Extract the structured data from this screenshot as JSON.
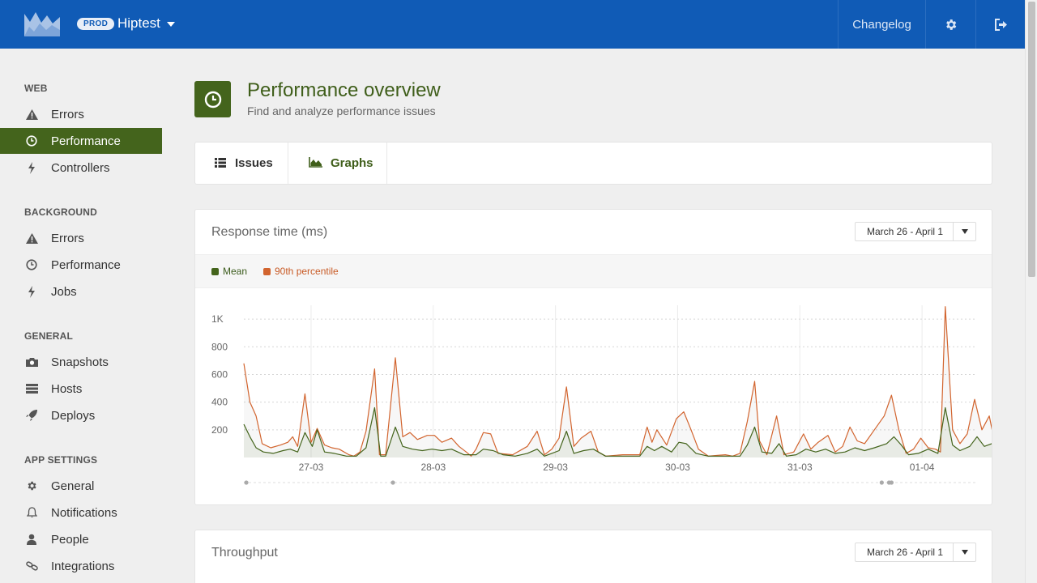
{
  "topbar": {
    "env_badge": "PROD",
    "app_name": "Hiptest",
    "changelog_label": "Changelog",
    "icons": {
      "logo": "mountain-logo",
      "app_menu": "caret-down-icon",
      "settings": "gear-icon",
      "logout": "sign-out-icon"
    }
  },
  "sidebar": {
    "sections": [
      {
        "title": "WEB",
        "items": [
          {
            "label": "Errors",
            "icon": "warning-icon"
          },
          {
            "label": "Performance",
            "icon": "clock-icon",
            "active": true
          },
          {
            "label": "Controllers",
            "icon": "bolt-icon"
          }
        ]
      },
      {
        "title": "BACKGROUND",
        "items": [
          {
            "label": "Errors",
            "icon": "warning-icon"
          },
          {
            "label": "Performance",
            "icon": "clock-icon"
          },
          {
            "label": "Jobs",
            "icon": "bolt-icon"
          }
        ]
      },
      {
        "title": "GENERAL",
        "items": [
          {
            "label": "Snapshots",
            "icon": "camera-icon"
          },
          {
            "label": "Hosts",
            "icon": "server-icon"
          },
          {
            "label": "Deploys",
            "icon": "rocket-icon"
          }
        ]
      },
      {
        "title": "APP SETTINGS",
        "items": [
          {
            "label": "General",
            "icon": "gear-icon"
          },
          {
            "label": "Notifications",
            "icon": "bell-icon"
          },
          {
            "label": "People",
            "icon": "user-icon"
          },
          {
            "label": "Integrations",
            "icon": "link-icon"
          }
        ]
      }
    ]
  },
  "header": {
    "title": "Performance overview",
    "subtitle": "Find and analyze performance issues",
    "icon": "clock-icon"
  },
  "tabs": [
    {
      "label": "Issues",
      "icon": "list-icon",
      "active": false
    },
    {
      "label": "Graphs",
      "icon": "area-chart-icon",
      "active": true
    }
  ],
  "response_card": {
    "title": "Response time (ms)",
    "range": "March 26 - April 1",
    "legend": [
      {
        "label": "Mean",
        "color": "#44641c"
      },
      {
        "label": "90th percentile",
        "color": "#d2642e"
      }
    ]
  },
  "throughput_card": {
    "title": "Throughput",
    "range": "March 26 - April 1"
  },
  "colors": {
    "brand_blue": "#105bb6",
    "accent_green": "#44641c",
    "p90_orange": "#d2642e"
  },
  "chart_data": {
    "type": "line",
    "title": "Response time (ms)",
    "xlabel": "",
    "ylabel": "",
    "ylim": [
      0,
      1100
    ],
    "yticks": [
      {
        "value": 200,
        "label": "200"
      },
      {
        "value": 400,
        "label": "400"
      },
      {
        "value": 600,
        "label": "600"
      },
      {
        "value": 800,
        "label": "800"
      },
      {
        "value": 1000,
        "label": "1K"
      }
    ],
    "xlim": [
      0,
      6
    ],
    "xticks": [
      {
        "value": 0.55,
        "label": "27-03"
      },
      {
        "value": 1.55,
        "label": "28-03"
      },
      {
        "value": 2.55,
        "label": "29-03"
      },
      {
        "value": 3.55,
        "label": "30-03"
      },
      {
        "value": 4.55,
        "label": "31-03"
      },
      {
        "value": 5.55,
        "label": "01-04"
      }
    ],
    "grid": true,
    "legend_position": "top-left",
    "series": [
      {
        "name": "90th percentile",
        "color": "#d2642e",
        "points": [
          [
            0.0,
            680
          ],
          [
            0.05,
            400
          ],
          [
            0.1,
            300
          ],
          [
            0.15,
            100
          ],
          [
            0.22,
            70
          ],
          [
            0.3,
            90
          ],
          [
            0.36,
            110
          ],
          [
            0.4,
            150
          ],
          [
            0.44,
            80
          ],
          [
            0.5,
            460
          ],
          [
            0.55,
            110
          ],
          [
            0.6,
            210
          ],
          [
            0.66,
            90
          ],
          [
            0.72,
            70
          ],
          [
            0.78,
            60
          ],
          [
            0.86,
            20
          ],
          [
            0.9,
            10
          ],
          [
            0.95,
            40
          ],
          [
            1.0,
            190
          ],
          [
            1.07,
            640
          ],
          [
            1.11,
            20
          ],
          [
            1.16,
            20
          ],
          [
            1.24,
            720
          ],
          [
            1.3,
            150
          ],
          [
            1.36,
            180
          ],
          [
            1.42,
            130
          ],
          [
            1.5,
            160
          ],
          [
            1.56,
            160
          ],
          [
            1.62,
            110
          ],
          [
            1.7,
            140
          ],
          [
            1.76,
            80
          ],
          [
            1.82,
            40
          ],
          [
            1.86,
            10
          ],
          [
            1.9,
            60
          ],
          [
            1.96,
            180
          ],
          [
            2.02,
            170
          ],
          [
            2.08,
            30
          ],
          [
            2.2,
            20
          ],
          [
            2.32,
            80
          ],
          [
            2.4,
            190
          ],
          [
            2.46,
            20
          ],
          [
            2.52,
            60
          ],
          [
            2.58,
            140
          ],
          [
            2.64,
            510
          ],
          [
            2.7,
            80
          ],
          [
            2.76,
            140
          ],
          [
            2.84,
            190
          ],
          [
            2.9,
            40
          ],
          [
            2.96,
            10
          ],
          [
            3.1,
            20
          ],
          [
            3.24,
            20
          ],
          [
            3.3,
            220
          ],
          [
            3.34,
            110
          ],
          [
            3.38,
            200
          ],
          [
            3.46,
            90
          ],
          [
            3.54,
            280
          ],
          [
            3.6,
            330
          ],
          [
            3.66,
            200
          ],
          [
            3.72,
            60
          ],
          [
            3.8,
            10
          ],
          [
            3.94,
            20
          ],
          [
            4.0,
            10
          ],
          [
            4.06,
            30
          ],
          [
            4.12,
            260
          ],
          [
            4.18,
            550
          ],
          [
            4.22,
            120
          ],
          [
            4.28,
            20
          ],
          [
            4.36,
            300
          ],
          [
            4.42,
            20
          ],
          [
            4.5,
            40
          ],
          [
            4.58,
            170
          ],
          [
            4.64,
            60
          ],
          [
            4.7,
            110
          ],
          [
            4.78,
            160
          ],
          [
            4.84,
            40
          ],
          [
            4.9,
            80
          ],
          [
            4.96,
            220
          ],
          [
            5.02,
            120
          ],
          [
            5.08,
            100
          ],
          [
            5.16,
            200
          ],
          [
            5.24,
            300
          ],
          [
            5.3,
            450
          ],
          [
            5.36,
            200
          ],
          [
            5.42,
            30
          ],
          [
            5.48,
            60
          ],
          [
            5.54,
            140
          ],
          [
            5.6,
            70
          ],
          [
            5.66,
            60
          ],
          [
            5.7,
            40
          ],
          [
            5.74,
            1090
          ],
          [
            5.8,
            200
          ],
          [
            5.86,
            100
          ],
          [
            5.92,
            170
          ],
          [
            5.98,
            420
          ],
          [
            6.04,
            200
          ],
          [
            6.1,
            300
          ],
          [
            6.16,
            40
          ],
          [
            6.22,
            60
          ],
          [
            6.3,
            580
          ],
          [
            6.36,
            450
          ],
          [
            6.42,
            80
          ],
          [
            6.48,
            20
          ],
          [
            6.54,
            20
          ],
          [
            6.6,
            10
          ],
          [
            6.7,
            30
          ],
          [
            6.8,
            80
          ],
          [
            6.9,
            130
          ]
        ]
      },
      {
        "name": "Mean",
        "color": "#44641c",
        "points": [
          [
            0.0,
            240
          ],
          [
            0.05,
            150
          ],
          [
            0.1,
            70
          ],
          [
            0.16,
            40
          ],
          [
            0.24,
            30
          ],
          [
            0.32,
            50
          ],
          [
            0.38,
            60
          ],
          [
            0.44,
            40
          ],
          [
            0.5,
            180
          ],
          [
            0.56,
            80
          ],
          [
            0.6,
            200
          ],
          [
            0.66,
            40
          ],
          [
            0.74,
            30
          ],
          [
            0.84,
            10
          ],
          [
            0.92,
            10
          ],
          [
            1.0,
            70
          ],
          [
            1.07,
            360
          ],
          [
            1.12,
            10
          ],
          [
            1.16,
            10
          ],
          [
            1.24,
            220
          ],
          [
            1.3,
            80
          ],
          [
            1.38,
            60
          ],
          [
            1.46,
            50
          ],
          [
            1.54,
            60
          ],
          [
            1.62,
            50
          ],
          [
            1.7,
            60
          ],
          [
            1.8,
            20
          ],
          [
            1.9,
            20
          ],
          [
            1.96,
            60
          ],
          [
            2.04,
            50
          ],
          [
            2.12,
            20
          ],
          [
            2.22,
            10
          ],
          [
            2.32,
            30
          ],
          [
            2.4,
            60
          ],
          [
            2.46,
            10
          ],
          [
            2.52,
            30
          ],
          [
            2.58,
            50
          ],
          [
            2.64,
            190
          ],
          [
            2.7,
            30
          ],
          [
            2.78,
            50
          ],
          [
            2.86,
            60
          ],
          [
            2.96,
            10
          ],
          [
            3.1,
            10
          ],
          [
            3.24,
            10
          ],
          [
            3.3,
            80
          ],
          [
            3.36,
            50
          ],
          [
            3.42,
            80
          ],
          [
            3.5,
            40
          ],
          [
            3.56,
            110
          ],
          [
            3.62,
            100
          ],
          [
            3.7,
            30
          ],
          [
            3.8,
            10
          ],
          [
            3.94,
            10
          ],
          [
            4.06,
            10
          ],
          [
            4.12,
            90
          ],
          [
            4.18,
            220
          ],
          [
            4.24,
            40
          ],
          [
            4.32,
            30
          ],
          [
            4.38,
            100
          ],
          [
            4.44,
            10
          ],
          [
            4.52,
            20
          ],
          [
            4.6,
            60
          ],
          [
            4.68,
            40
          ],
          [
            4.76,
            60
          ],
          [
            4.84,
            30
          ],
          [
            4.92,
            40
          ],
          [
            5.0,
            70
          ],
          [
            5.08,
            50
          ],
          [
            5.16,
            70
          ],
          [
            5.26,
            100
          ],
          [
            5.32,
            150
          ],
          [
            5.38,
            90
          ],
          [
            5.44,
            20
          ],
          [
            5.52,
            30
          ],
          [
            5.6,
            60
          ],
          [
            5.68,
            30
          ],
          [
            5.74,
            360
          ],
          [
            5.8,
            90
          ],
          [
            5.86,
            50
          ],
          [
            5.94,
            80
          ],
          [
            6.0,
            150
          ],
          [
            6.06,
            80
          ],
          [
            6.12,
            100
          ],
          [
            6.2,
            20
          ],
          [
            6.26,
            30
          ],
          [
            6.3,
            220
          ],
          [
            6.36,
            160
          ],
          [
            6.42,
            40
          ],
          [
            6.5,
            10
          ],
          [
            6.6,
            10
          ],
          [
            6.7,
            20
          ],
          [
            6.8,
            40
          ],
          [
            6.9,
            60
          ]
        ]
      }
    ],
    "markers": [
      0.02,
      1.22,
      5.22,
      5.28,
      5.3
    ]
  }
}
